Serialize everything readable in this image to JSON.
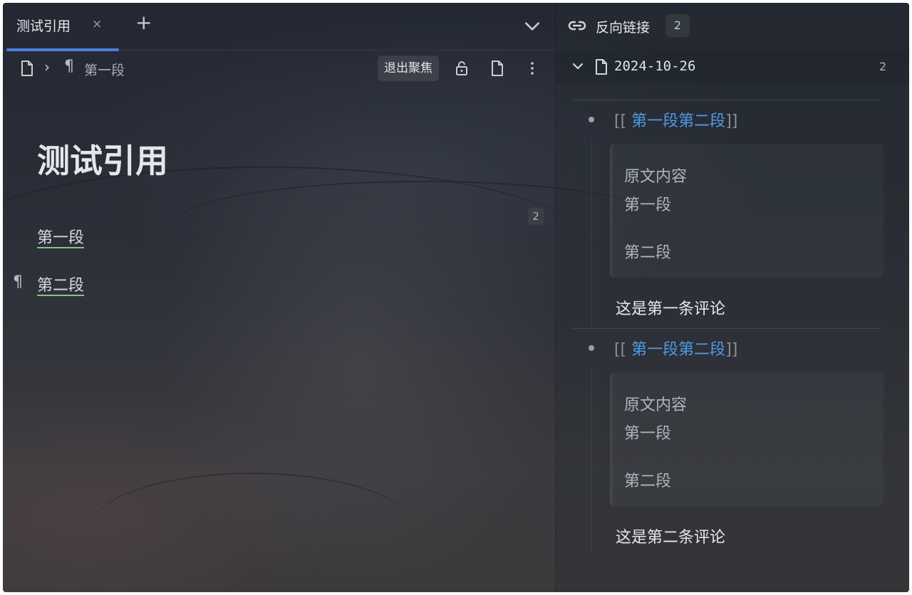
{
  "tab": {
    "title": "测试引用",
    "close": "×",
    "add": "+"
  },
  "breadcrumb": {
    "separator": "›",
    "para_mark": "¶",
    "label": "第一段"
  },
  "toolbar": {
    "exit_focus": "退出聚焦"
  },
  "doc": {
    "title": "测试引用",
    "ref_count": "2",
    "paragraphs": [
      "第一段",
      "第二段"
    ],
    "para_mark": "¶"
  },
  "backlinks": {
    "title": "反向链接",
    "count": "2",
    "group": {
      "date": "2024-10-26",
      "count": "2"
    },
    "entries": [
      {
        "open": "[[",
        "link": "第一段第二段",
        "close": "]]",
        "quote": [
          "原文内容",
          "第一段",
          "第二段"
        ],
        "comment": "这是第一条评论"
      },
      {
        "open": "[[",
        "link": "第一段第二段",
        "close": "]]",
        "quote": [
          "原文内容",
          "第一段",
          "第二段"
        ],
        "comment": "这是第二条评论"
      }
    ]
  },
  "colors": {
    "accent": "#4c7ee0",
    "link": "#4f9be6",
    "underline": "#8fbf84"
  }
}
